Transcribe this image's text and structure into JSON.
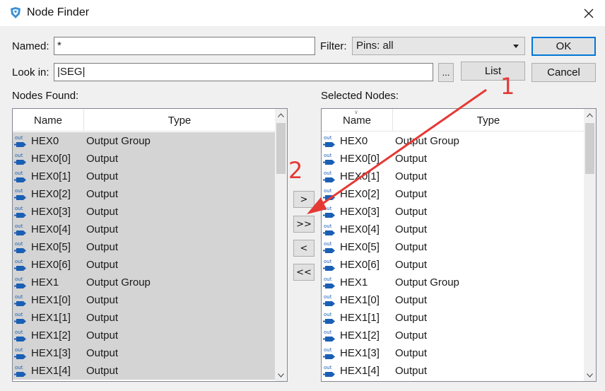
{
  "window": {
    "title": "Node Finder",
    "icon": "quartus-app-icon"
  },
  "named": {
    "label": "Named:",
    "value": "*"
  },
  "filter": {
    "label": "Filter:",
    "value": "Pins: all"
  },
  "lookin": {
    "label": "Look in:",
    "value": "|SEG|"
  },
  "buttons": {
    "ok": "OK",
    "browse": "...",
    "list": "List",
    "cancel": "Cancel",
    "add_one": ">",
    "add_all": ">>",
    "remove_one": "<",
    "remove_all": "<<"
  },
  "nodes_found": {
    "label": "Nodes Found:",
    "columns": [
      "Name",
      "Type"
    ],
    "rows": [
      {
        "name": "HEX0",
        "type": "Output Group"
      },
      {
        "name": "HEX0[0]",
        "type": "Output"
      },
      {
        "name": "HEX0[1]",
        "type": "Output"
      },
      {
        "name": "HEX0[2]",
        "type": "Output"
      },
      {
        "name": "HEX0[3]",
        "type": "Output"
      },
      {
        "name": "HEX0[4]",
        "type": "Output"
      },
      {
        "name": "HEX0[5]",
        "type": "Output"
      },
      {
        "name": "HEX0[6]",
        "type": "Output"
      },
      {
        "name": "HEX1",
        "type": "Output Group"
      },
      {
        "name": "HEX1[0]",
        "type": "Output"
      },
      {
        "name": "HEX1[1]",
        "type": "Output"
      },
      {
        "name": "HEX1[2]",
        "type": "Output"
      },
      {
        "name": "HEX1[3]",
        "type": "Output"
      },
      {
        "name": "HEX1[4]",
        "type": "Output"
      }
    ]
  },
  "selected_nodes": {
    "label": "Selected Nodes:",
    "columns": [
      "Name",
      "Type"
    ],
    "rows": [
      {
        "name": "HEX0",
        "type": "Output Group"
      },
      {
        "name": "HEX0[0]",
        "type": "Output"
      },
      {
        "name": "HEX0[1]",
        "type": "Output"
      },
      {
        "name": "HEX0[2]",
        "type": "Output"
      },
      {
        "name": "HEX0[3]",
        "type": "Output"
      },
      {
        "name": "HEX0[4]",
        "type": "Output"
      },
      {
        "name": "HEX0[5]",
        "type": "Output"
      },
      {
        "name": "HEX0[6]",
        "type": "Output"
      },
      {
        "name": "HEX1",
        "type": "Output Group"
      },
      {
        "name": "HEX1[0]",
        "type": "Output"
      },
      {
        "name": "HEX1[1]",
        "type": "Output"
      },
      {
        "name": "HEX1[2]",
        "type": "Output"
      },
      {
        "name": "HEX1[3]",
        "type": "Output"
      },
      {
        "name": "HEX1[4]",
        "type": "Output"
      }
    ]
  },
  "annotations": {
    "step1": "1",
    "step2": "2",
    "color": "#e53935"
  },
  "pin_icon": {
    "text": "out",
    "color": "#1a5fb4"
  }
}
